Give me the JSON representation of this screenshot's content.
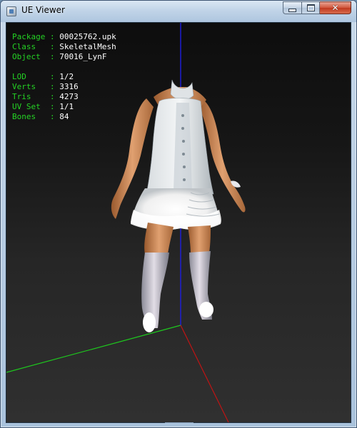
{
  "window": {
    "title": "UE Viewer",
    "controls": {
      "minimize": "minimize",
      "maximize": "maximize",
      "close": "close"
    }
  },
  "info": {
    "package": {
      "label": "Package",
      "value": "00025762.upk"
    },
    "class": {
      "label": "Class  ",
      "value": "SkeletalMesh"
    },
    "object": {
      "label": "Object ",
      "value": "70016_LynF"
    },
    "lod": {
      "label": "LOD    ",
      "value": "1/2"
    },
    "verts": {
      "label": "Verts  ",
      "value": "3316"
    },
    "tris": {
      "label": "Tris   ",
      "value": "4273"
    },
    "uvset": {
      "label": "UV Set ",
      "value": "1/1"
    },
    "bones": {
      "label": "Bones  ",
      "value": "84"
    },
    "separator": " : "
  },
  "colors": {
    "label": "#24d224",
    "value": "#ffffff",
    "axis_x": "#c01414",
    "axis_y": "#1ec81e",
    "axis_z": "#1e1ee0"
  },
  "icons": {
    "app": "ue-viewer-app-icon",
    "minimize": "minimize-icon",
    "maximize": "maximize-icon",
    "close": "close-icon"
  }
}
